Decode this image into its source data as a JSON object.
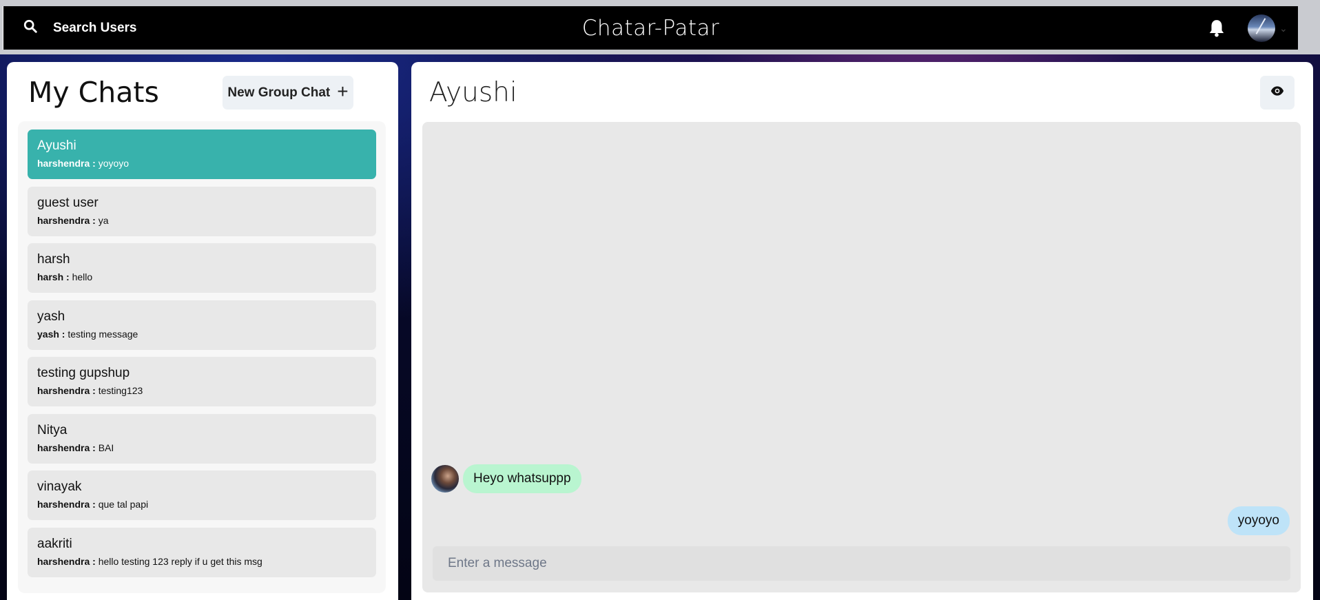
{
  "header": {
    "search_label": "Search Users",
    "app_title": "Chatar-Patar",
    "icons": {
      "search": "search-icon",
      "bell": "bell-icon",
      "avatar": "avatar",
      "chevron": "chevron-down-icon"
    }
  },
  "left": {
    "title": "My Chats",
    "new_group_label": "New Group Chat",
    "new_group_icon": "+",
    "chats": [
      {
        "name": "Ayushi",
        "sender": "harshendra :",
        "message": "yoyoyo",
        "active": true
      },
      {
        "name": "guest user",
        "sender": "harshendra :",
        "message": "ya"
      },
      {
        "name": "harsh",
        "sender": "harsh :",
        "message": "hello"
      },
      {
        "name": "yash",
        "sender": "yash :",
        "message": "testing message"
      },
      {
        "name": "testing gupshup",
        "sender": "harshendra :",
        "message": "testing123"
      },
      {
        "name": "Nitya",
        "sender": "harshendra :",
        "message": "BAI"
      },
      {
        "name": "vinayak",
        "sender": "harshendra :",
        "message": "que tal papi"
      },
      {
        "name": "aakriti",
        "sender": "harshendra :",
        "message": "hello testing 123 reply if u get this msg"
      }
    ]
  },
  "right": {
    "chat_title": "Ayushi",
    "messages": [
      {
        "text": "Heyo whatsuppp",
        "from": "other"
      },
      {
        "text": "yoyoyo",
        "from": "self"
      }
    ],
    "input_placeholder": "Enter a message"
  },
  "colors": {
    "active_chat": "#38b2ac",
    "received_bubble": "#b9f5d0",
    "sent_bubble": "#bee3f8"
  }
}
